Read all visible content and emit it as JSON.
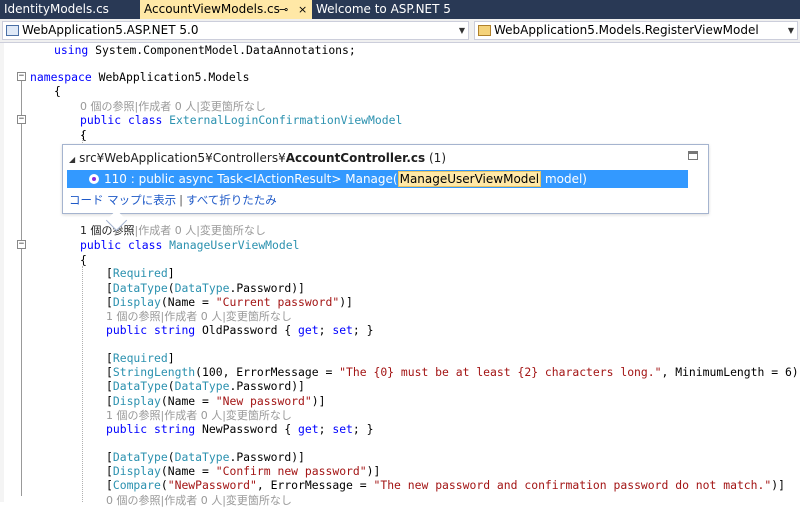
{
  "tabs": [
    {
      "label": "IdentityModels.cs",
      "active": false
    },
    {
      "label": "AccountViewModels.cs",
      "active": true,
      "pin_glyph": "⊸",
      "close_glyph": "×"
    },
    {
      "label": "Welcome to ASP.NET 5",
      "active": false
    }
  ],
  "navbar": {
    "project": "WebApplication5.ASP.NET 5.0",
    "member": "WebApplication5.Models.RegisterViewModel"
  },
  "code": {
    "using": [
      "using",
      " System.ComponentModel.DataAnnotations;"
    ],
    "namespace": [
      "namespace",
      " WebApplication5.Models"
    ],
    "brace_open": "{",
    "lens_ext": "0 個の参照|作成者 0 人|変更箇所なし",
    "ext_class": [
      "public",
      " ",
      "class",
      " ExternalLoginConfirmationViewModel"
    ],
    "lens_mgr_ref": "1 個の参照",
    "lens_mgr_rest": "|作成者 0 人|変更箇所なし",
    "mgr_class": [
      "public",
      " ",
      "class",
      " ManageUserViewModel"
    ],
    "required": "Required",
    "datatype": "DataType",
    "datatype_arg": "DataType",
    "password": ".Password)]",
    "display": "Display",
    "name_eq": "(Name = ",
    "current_pw": "\"Current password\"",
    "new_pw": "\"New password\"",
    "confirm_pw": "\"Confirm new password\"",
    "lens_1ref": "1 個の参照|作成者 0 人|変更箇所なし",
    "lens_0ref": "0 個の参照|作成者 0 人|変更箇所なし",
    "prop_old": [
      "public",
      " ",
      "string",
      " OldPassword { ",
      "get",
      "; ",
      "set",
      "; }"
    ],
    "prop_new": [
      "public",
      " ",
      "string",
      " NewPassword { ",
      "get",
      "; ",
      "set",
      "; }"
    ],
    "stringlength": "StringLength",
    "sl_args": "(100, ErrorMessage = ",
    "sl_msg": "\"The {0} must be at least {2} characters long.\"",
    "sl_tail": ", MinimumLength = 6)]",
    "compare": "Compare",
    "cmp_arg1": "\"NewPassword\"",
    "cmp_mid": ", ErrorMessage = ",
    "cmp_msg": "\"The new password and confirmation password do not match.\"",
    "cmp_tail": ")]"
  },
  "popup": {
    "path_prefix": "src¥WebApplication5¥Controllers¥",
    "file": "AccountController.cs",
    "count": " (1)",
    "ref_pre": "110 : public async Task<IActionResult> Manage(",
    "ref_hl": "ManageUserViewModel",
    "ref_post": " model)",
    "link_map": "コード マップに表示",
    "link_sep": "|",
    "link_collapse": "すべて折りたたみ"
  },
  "colors": {
    "keyword": "#0000ff",
    "type": "#2b91af",
    "string": "#a31515",
    "tab_active": "#ffe8a6",
    "tab_strip": "#293955",
    "selection": "#3399ff"
  }
}
